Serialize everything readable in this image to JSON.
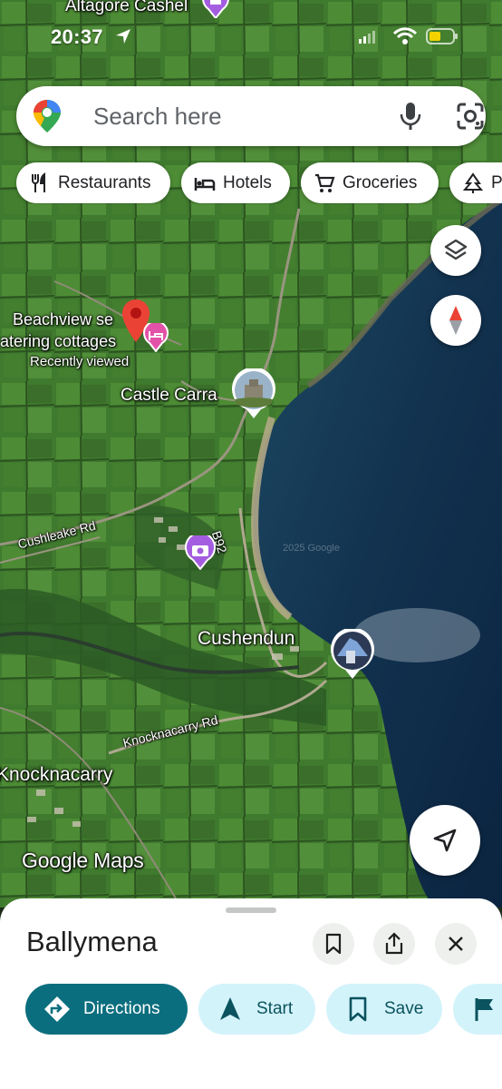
{
  "status_bar": {
    "time": "20:37"
  },
  "search": {
    "placeholder": "Search here"
  },
  "chips": [
    {
      "label": "Restaurants",
      "icon": "fork-knife-icon"
    },
    {
      "label": "Hotels",
      "icon": "bed-icon"
    },
    {
      "label": "Groceries",
      "icon": "cart-icon"
    },
    {
      "label": "Pa",
      "icon": "tree-icon"
    }
  ],
  "map": {
    "places": {
      "top_label": "Altagore Cashel",
      "beachview_line1": "Beachview se",
      "beachview_line2": "atering cottages",
      "recently_viewed": "Recently viewed",
      "castle": "Castle Carra",
      "cushendun": "Cushendun",
      "knocknacarry": "Knocknacarry"
    },
    "roads": {
      "cushleake": "Cushleake Rd",
      "knocknacarry_rd": "Knocknacarry Rd",
      "b92": "B92"
    },
    "watermark": "Google Maps",
    "imagery_credit": "2025 Google"
  },
  "sheet": {
    "title": "Ballymena",
    "actions": [
      {
        "label": "Directions",
        "icon": "directions-icon"
      },
      {
        "label": "Start",
        "icon": "navigation-arrow-icon"
      },
      {
        "label": "Save",
        "icon": "bookmark-icon"
      },
      {
        "label": "",
        "icon": "flag-icon"
      }
    ]
  },
  "colors": {
    "primary_teal": "#0b6e7e",
    "action_tint": "#d3f3fb",
    "marker_red": "#ea4335",
    "hotel_pink": "#e252a8",
    "attraction_purple": "#a45de0"
  }
}
